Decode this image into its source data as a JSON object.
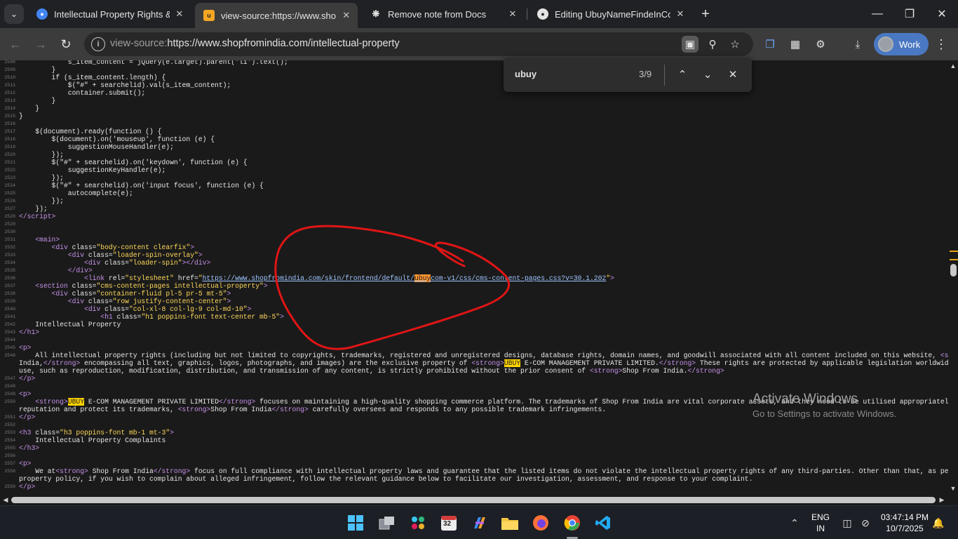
{
  "browser": {
    "tabs": [
      {
        "title": "Intellectual Property Rights & U",
        "favicon": "chrome-globe-icon",
        "active": false
      },
      {
        "title": "view-source:https://www.shopfr",
        "favicon": "ubuy-favicon",
        "active": true
      },
      {
        "title": "Remove note from Docs",
        "favicon": "openai-icon",
        "active": false
      },
      {
        "title": "Editing UbuyNameFindeInCode",
        "favicon": "github-icon",
        "active": false
      }
    ],
    "new_tab_glyph": "+",
    "address_prefix": "view-source:",
    "address_url": "https://www.shopfromindia.com/intellectual-property",
    "profile_label": "Work"
  },
  "find_bar": {
    "query": "ubuy",
    "count": "3/9"
  },
  "source_lines": [
    {
      "n": "2508",
      "html": "            s_item_content = jQuery(e.target).parent('li').text();"
    },
    {
      "n": "2509",
      "html": "        }"
    },
    {
      "n": "2510",
      "html": "        if (s_item_content.length) {"
    },
    {
      "n": "2511",
      "html": "            $(\"#\" + searchelid).val(s_item_content);"
    },
    {
      "n": "2512",
      "html": "            container.submit();"
    },
    {
      "n": "2513",
      "html": "        }"
    },
    {
      "n": "2514",
      "html": "    }"
    },
    {
      "n": "2515",
      "html": "}"
    },
    {
      "n": "2516",
      "html": ""
    },
    {
      "n": "2517",
      "html": "    $(document).ready(function () {"
    },
    {
      "n": "2518",
      "html": "        $(document).on('mouseup', function (e) {"
    },
    {
      "n": "2519",
      "html": "            suggestionMouseHandler(e);"
    },
    {
      "n": "2520",
      "html": "        });"
    },
    {
      "n": "2521",
      "html": "        $(\"#\" + searchelid).on('keydown', function (e) {"
    },
    {
      "n": "2522",
      "html": "            suggestionKeyHandler(e);"
    },
    {
      "n": "2523",
      "html": "        });"
    },
    {
      "n": "2524",
      "html": "        $(\"#\" + searchelid).on('input focus', function (e) {"
    },
    {
      "n": "2525",
      "html": "            autocomplete(e);"
    },
    {
      "n": "2526",
      "html": "        });"
    },
    {
      "n": "2527",
      "html": "    });"
    },
    {
      "n": "2528",
      "html": "<span class=\"t-tag\">&lt;/script&gt;</span>"
    },
    {
      "n": "2529",
      "html": ""
    },
    {
      "n": "2530",
      "html": ""
    },
    {
      "n": "2531",
      "html": "    <span class=\"t-tag\">&lt;main&gt;</span>"
    },
    {
      "n": "2532",
      "html": "        <span class=\"t-tag\">&lt;div </span><span class=\"t-attr\">class=</span><span class=\"t-val\">\"body-content clearfix\"</span><span class=\"t-tag\">&gt;</span>"
    },
    {
      "n": "2533",
      "html": "            <span class=\"t-tag\">&lt;div </span><span class=\"t-attr\">class=</span><span class=\"t-val\">\"loader-spin-overlay\"</span><span class=\"t-tag\">&gt;</span>"
    },
    {
      "n": "2534",
      "html": "                <span class=\"t-tag\">&lt;div </span><span class=\"t-attr\">class=</span><span class=\"t-val\">\"loader-spin\"</span><span class=\"t-tag\">&gt;&lt;/div&gt;</span>"
    },
    {
      "n": "2535",
      "html": "            <span class=\"t-tag\">&lt;/div&gt;</span>"
    },
    {
      "n": "2536",
      "html": "                <span class=\"t-tag\">&lt;link </span><span class=\"t-attr\">rel=</span><span class=\"t-val\">\"stylesheet\"</span><span class=\"t-attr\"> href=</span><span class=\"t-val\">\"</span><span class=\"t-link\">https://www.shopfromindia.com/skin/frontend/default/<span class=\"hl-active\">ubuy</span>com-v1/css/cms-content-pages.css?v=30.1.202</span><span class=\"t-val\">\"</span><span class=\"t-tag\">&gt;</span>"
    },
    {
      "n": "2537",
      "html": "    <span class=\"t-tag\">&lt;section </span><span class=\"t-attr\">class=</span><span class=\"t-val\">\"cms-content-pages intellectual-property\"</span><span class=\"t-tag\">&gt;</span>"
    },
    {
      "n": "2538",
      "html": "        <span class=\"t-tag\">&lt;div </span><span class=\"t-attr\">class=</span><span class=\"t-val\">\"container-fluid pl-5 pr-5 mt-5\"</span><span class=\"t-tag\">&gt;</span>"
    },
    {
      "n": "2539",
      "html": "            <span class=\"t-tag\">&lt;div </span><span class=\"t-attr\">class=</span><span class=\"t-val\">\"row justify-content-center\"</span><span class=\"t-tag\">&gt;</span>"
    },
    {
      "n": "2540",
      "html": "                <span class=\"t-tag\">&lt;div </span><span class=\"t-attr\">class=</span><span class=\"t-val\">\"col-xl-8 col-lg-9 col-md-10\"</span><span class=\"t-tag\">&gt;</span>"
    },
    {
      "n": "2541",
      "html": "                    <span class=\"t-tag\">&lt;h1 </span><span class=\"t-attr\">class=</span><span class=\"t-val\">\"h1 poppins-font text-center mb-5\"</span><span class=\"t-tag\">&gt;</span>"
    },
    {
      "n": "2542",
      "html": "    Intellectual Property"
    },
    {
      "n": "2543",
      "html": "<span class=\"t-tag\">&lt;/h1&gt;</span>"
    },
    {
      "n": "2544",
      "html": ""
    },
    {
      "n": "2545",
      "html": "<span class=\"t-tag\">&lt;p&gt;</span>"
    },
    {
      "n": "2546",
      "html": "    All intellectual property rights (including but not limited to copyrights, trademarks, registered and unregistered designs, database rights, domain names, and goodwill associated with all content included on this website, <span class=\"t-tag\">&lt;strong&gt;</span>Shop From"
    },
    {
      "n": "",
      "html": "India,<span class=\"t-tag\">&lt;/strong&gt;</span> encompassing all text, graphics, logos, photographs, and images) are the exclusive property of <span class=\"t-tag\">&lt;strong&gt;</span><span class=\"hl\">UBUY</span> E-COM MANAGEMENT PRIVATE LIMITED.<span class=\"t-tag\">&lt;/strong&gt;</span> These rights are protected by applicable legislation worldwide. The commercial"
    },
    {
      "n": "",
      "html": "use, such as reproduction, modification, distribution, and transmission of any content, is strictly prohibited without the prior consent of <span class=\"t-tag\">&lt;strong&gt;</span>Shop From India.<span class=\"t-tag\">&lt;/strong&gt;</span>"
    },
    {
      "n": "2547",
      "html": "<span class=\"t-tag\">&lt;/p&gt;</span>"
    },
    {
      "n": "2548",
      "html": ""
    },
    {
      "n": "2549",
      "html": "<span class=\"t-tag\">&lt;p&gt;</span>"
    },
    {
      "n": "2550",
      "html": "    <span class=\"t-tag\">&lt;strong&gt;</span><span class=\"hl\">UBUY</span> E-COM MANAGEMENT PRIVATE LIMITED<span class=\"t-tag\">&lt;/strong&gt;</span> focuses on maintaining a high-quality shopping commerce platform. The trademarks of Shop From India are vital corporate assets, and they need to be utilised appropriately. To support its"
    },
    {
      "n": "",
      "html": "reputation and protect its trademarks, <span class=\"t-tag\">&lt;strong&gt;</span>Shop From India<span class=\"t-tag\">&lt;/strong&gt;</span> carefully oversees and responds to any possible trademark infringements."
    },
    {
      "n": "2551",
      "html": "<span class=\"t-tag\">&lt;/p&gt;</span>"
    },
    {
      "n": "2552",
      "html": ""
    },
    {
      "n": "2553",
      "html": "<span class=\"t-tag\">&lt;h3 </span><span class=\"t-attr\">class=</span><span class=\"t-val\">\"h3 poppins-font mb-1 mt-3\"</span><span class=\"t-tag\">&gt;</span>"
    },
    {
      "n": "2554",
      "html": "    Intellectual Property Complaints"
    },
    {
      "n": "2555",
      "html": "<span class=\"t-tag\">&lt;/h3&gt;</span>"
    },
    {
      "n": "2556",
      "html": ""
    },
    {
      "n": "2557",
      "html": "<span class=\"t-tag\">&lt;p&gt;</span>"
    },
    {
      "n": "2558",
      "html": "    We at<span class=\"t-tag\">&lt;strong&gt;</span> Shop From India<span class=\"t-tag\">&lt;/strong&gt;</span> focus on full compliance with intellectual property laws and guarantee that the listed items do not violate the intellectual property rights of any third-parties. Other than that, as per our intellectual"
    },
    {
      "n": "",
      "html": "property policy, if you wish to complain about alleged infringement, follow the relevant guidance below to facilitate our investigation, assessment, and response to your complaint."
    },
    {
      "n": "2559",
      "html": "<span class=\"t-tag\">&lt;/p&gt;</span>"
    }
  ],
  "watermark": {
    "line1": "Activate Windows",
    "line2": "Go to Settings to activate Windows."
  },
  "taskbar": {
    "language": "ENG",
    "region": "IN",
    "time": "03:47:14 PM",
    "date": "10/7/2025",
    "calendar_badge": "32"
  }
}
